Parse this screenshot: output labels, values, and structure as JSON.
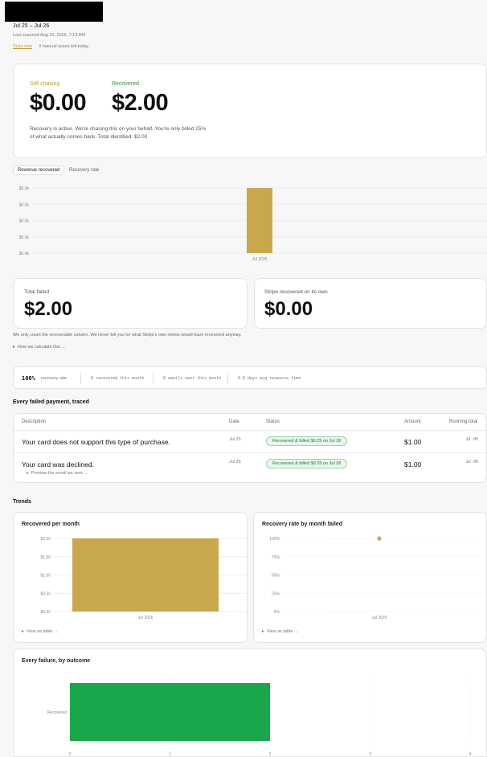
{
  "header": {
    "date_range": "Jul 25 – Jul 26",
    "last_scanned": "Last scanned Aug 15, 2026, 7:13 AM",
    "scan_now": "Scan now",
    "scans_left": "3 manual scans left today"
  },
  "summary": {
    "still_chasing_label": "Still chasing",
    "still_chasing_value": "$0.00",
    "recovered_label": "Recovered",
    "recovered_value": "$2.00",
    "note_line1": "Recovery is active. We're chasing this on your behalf. You're only billed 25%",
    "note_line2": "of what actually comes back. Total identified: $2.00."
  },
  "tabs": [
    "Revenue recovered",
    "Recovery rate"
  ],
  "colors": {
    "gold": "#c9a84c",
    "green": "#1aa64a",
    "accent_gold_text": "#c39b2e"
  },
  "totals": {
    "total_failed_label": "Total failed",
    "total_failed_value": "$2.00",
    "stripe_label": "Stripe recovered on its own",
    "stripe_value": "$0.00",
    "explain": "We only count the recoverable column. We never bill you for what Stripe's own retries would have recovered anyway.",
    "how_link": "How we calculate this →"
  },
  "stats": {
    "rate": "100%",
    "rate_label": "recovery rate",
    "recovered_month": "0 recovered this month",
    "emails_month": "0 emails sent this month",
    "response": "0.0 days avg response time"
  },
  "table": {
    "section": "Every failed payment, traced",
    "headers": [
      "Description",
      "Date",
      "Status",
      "Amount",
      "Running total"
    ],
    "rows": [
      {
        "desc": "Your card does not support this type of purchase.",
        "date": "Jul 25",
        "status": "Recovered & billed $0.25 on Jul 28",
        "amount": "$1.00",
        "running": "$1.00"
      },
      {
        "desc": "Your card was declined.",
        "date": "Jul 26",
        "status": "Recovered & billed $0.25 on Jul 28",
        "amount": "$1.00",
        "running": "$2.00",
        "sub": "Preview the email we sent →"
      }
    ]
  },
  "trends": {
    "section": "Trends",
    "per_month_title": "Recovered per month",
    "rate_title": "Recovery rate by month failed",
    "view_table": "View as table →",
    "outcome_title": "Every failure, by outcome"
  },
  "chart_data": [
    {
      "type": "bar",
      "categories": [
        "Jul 2026"
      ],
      "values": [
        2.0
      ],
      "yticks": [
        "$0.0k",
        "$0.0k",
        "$0.0k",
        "$0.0k",
        "$0.0k"
      ],
      "ylim": [
        0,
        2
      ]
    },
    {
      "type": "bar",
      "categories": [
        "Jul 2026"
      ],
      "values": [
        2.0
      ],
      "yticks": [
        "$2.00",
        "$1.50",
        "$1.00",
        "$0.50",
        "$0.00"
      ],
      "ylim": [
        0,
        2
      ]
    },
    {
      "type": "scatter",
      "categories": [
        "Jul 2026"
      ],
      "values": [
        100
      ],
      "yticks": [
        "100%",
        "75%",
        "50%",
        "25%",
        "0%"
      ],
      "ylim": [
        0,
        100
      ]
    },
    {
      "type": "bar",
      "categories": [
        "Recovered"
      ],
      "values": [
        2
      ],
      "xticks": [
        "0",
        "1",
        "2",
        "3",
        "4"
      ],
      "xlim": [
        0,
        4
      ]
    }
  ]
}
